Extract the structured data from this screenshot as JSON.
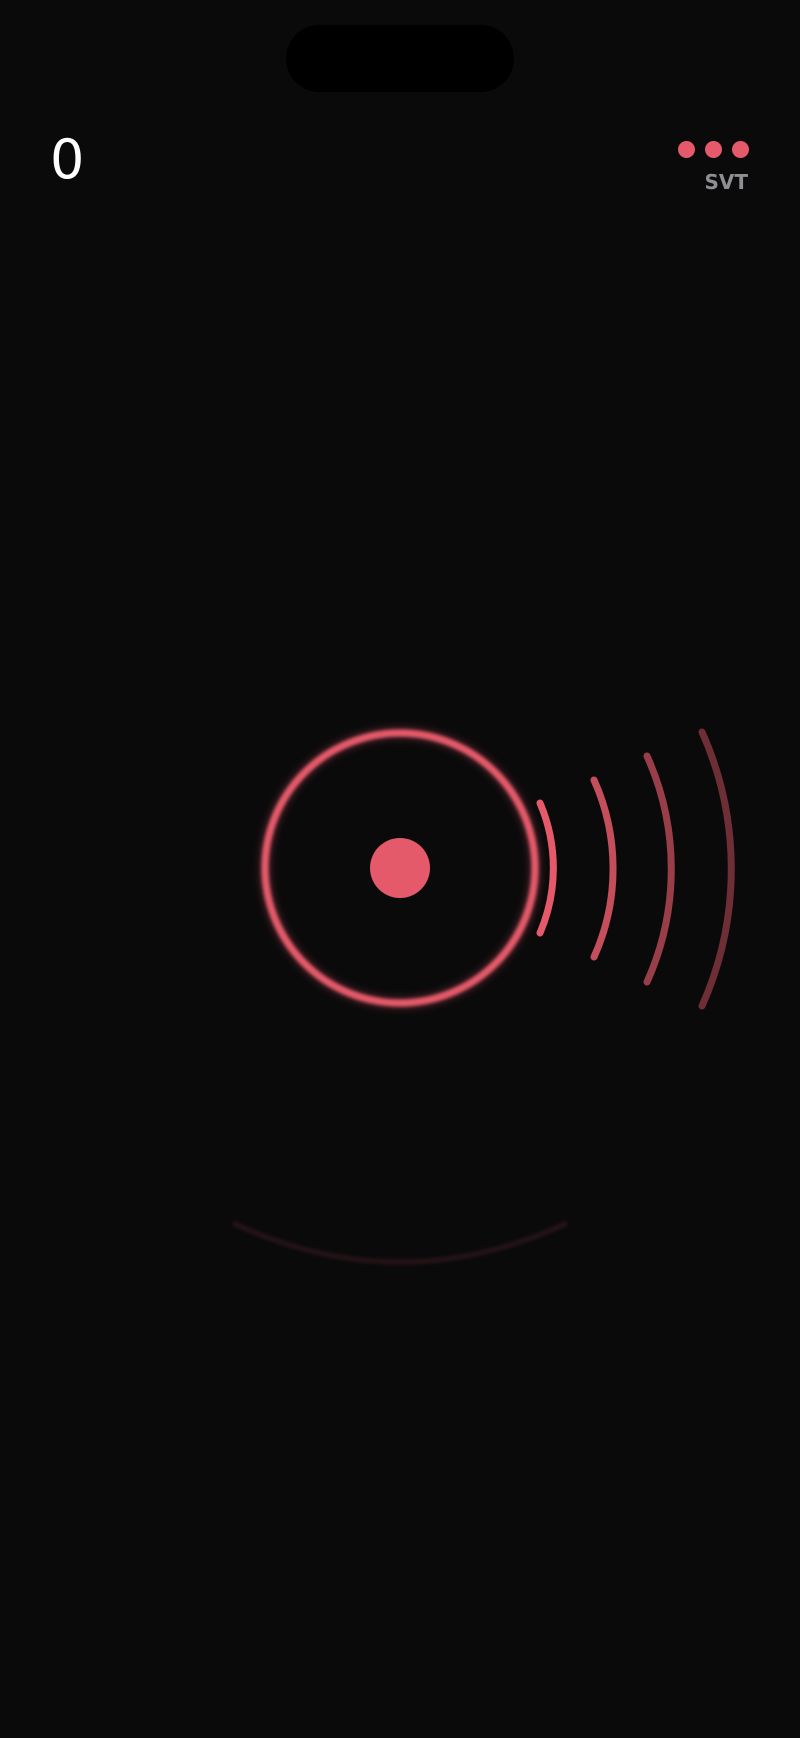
{
  "game": {
    "score": "0",
    "mode_label": "SVT",
    "progress_dots_total": 3,
    "progress_dots_filled": 3
  },
  "colors": {
    "background": "#0b0a0b",
    "accent": "#e55a6a",
    "text_primary": "#ffffff",
    "text_secondary": "#8e8e93"
  },
  "icons": {
    "target": "concentric-ring-target-icon",
    "signal": "sound-wave-arcs-icon",
    "menu": "three-dots-icon"
  }
}
